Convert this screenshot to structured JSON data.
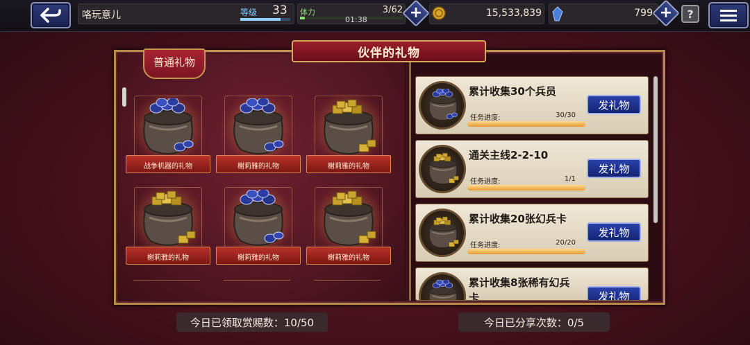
{
  "topbar": {
    "player_name": "咯玩意儿",
    "level_label": "等级",
    "level_value": "33",
    "stamina_label": "体力",
    "stamina_value": "3/62",
    "stamina_timer": "01:38",
    "stamina_fraction": 0.05,
    "gold_value": "15,533,839",
    "gem_value": "799",
    "help_symbol": "?"
  },
  "panel": {
    "title": "伙伴的礼物",
    "tab_label": "普通礼物"
  },
  "gifts": [
    {
      "label": "战争机器的礼物",
      "kind": "blue"
    },
    {
      "label": "榭莉雅的礼物",
      "kind": "blue"
    },
    {
      "label": "榭莉雅的礼物",
      "kind": "gold"
    },
    {
      "label": "榭莉雅的礼物",
      "kind": "gold"
    },
    {
      "label": "榭莉雅的礼物",
      "kind": "blue"
    },
    {
      "label": "榭莉雅的礼物",
      "kind": "gold"
    }
  ],
  "missions": [
    {
      "title": "累计收集30个兵员",
      "progress_label": "任务进度:",
      "progress": "30/30",
      "fraction": 1.0,
      "button": "发礼物",
      "icon": "blue"
    },
    {
      "title": "通关主线2-2-10",
      "progress_label": "任务进度:",
      "progress": "1/1",
      "fraction": 1.0,
      "button": "发礼物",
      "icon": "gold"
    },
    {
      "title": "累计收集20张幻兵卡",
      "progress_label": "任务进度:",
      "progress": "20/20",
      "fraction": 1.0,
      "button": "发礼物",
      "icon": "gold"
    },
    {
      "title": "累计收集8张稀有幻兵卡",
      "progress_label": "",
      "progress": "",
      "fraction": 1.0,
      "button": "发礼物",
      "icon": "blue"
    }
  ],
  "footer": {
    "rewards_today": "今日已领取赏赐数：10/50",
    "shares_today": "今日已分享次数：0/5"
  }
}
